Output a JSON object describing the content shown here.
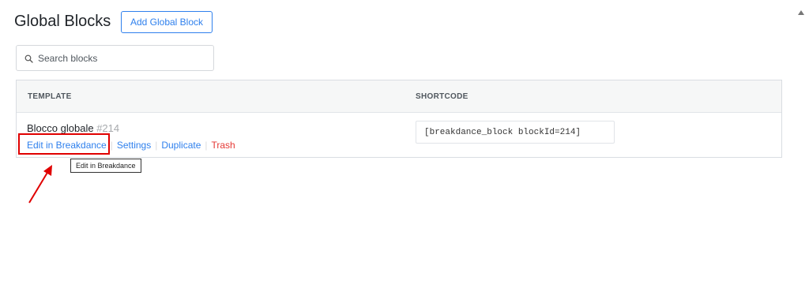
{
  "header": {
    "title": "Global Blocks",
    "add_button_label": "Add Global Block"
  },
  "search": {
    "placeholder": "Search blocks",
    "value": ""
  },
  "table": {
    "columns": [
      "TEMPLATE",
      "SHORTCODE"
    ],
    "rows": [
      {
        "title": "Blocco globale",
        "id": "#214",
        "actions": {
          "edit": "Edit in Breakdance",
          "settings": "Settings",
          "duplicate": "Duplicate",
          "trash": "Trash"
        },
        "shortcode": "[breakdance_block blockId=214]"
      }
    ]
  },
  "tooltip": "Edit in Breakdance",
  "colors": {
    "accent": "#2f80ed",
    "danger": "#e53935",
    "annotation": "#e00000"
  },
  "icons": {
    "search": "search-icon",
    "annotation_arrow": "arrow-icon",
    "scroll_up": "scroll-up-icon"
  }
}
